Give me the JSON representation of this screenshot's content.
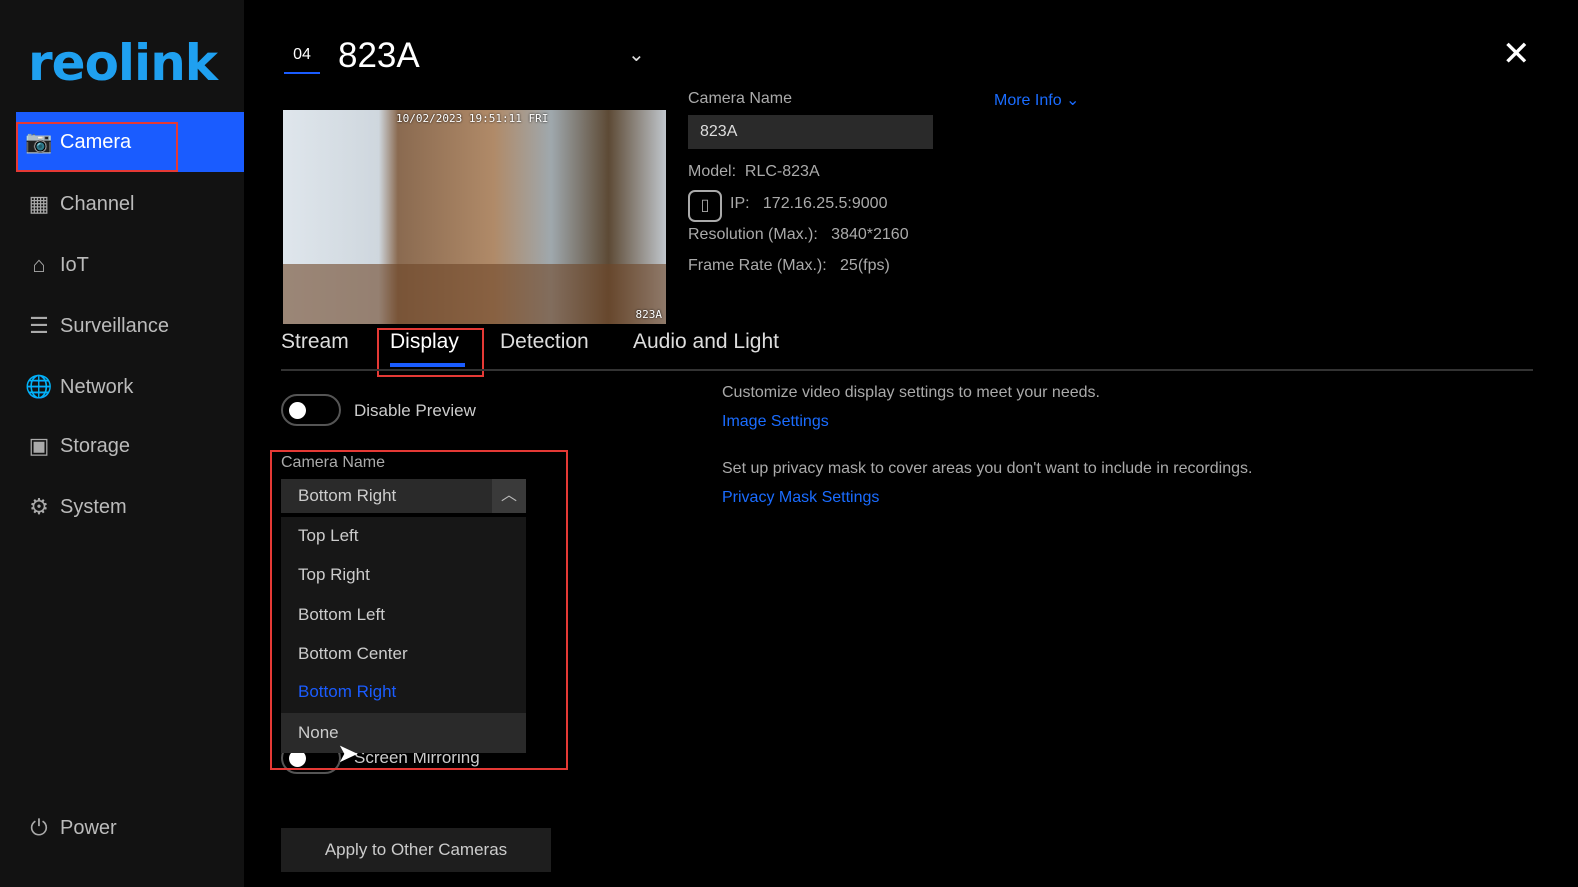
{
  "brand": "reolink",
  "sidebar": {
    "items": [
      {
        "label": "Camera",
        "icon": "camera-icon",
        "active": true
      },
      {
        "label": "Channel",
        "icon": "grid-icon"
      },
      {
        "label": "IoT",
        "icon": "home-icon"
      },
      {
        "label": "Surveillance",
        "icon": "list-icon"
      },
      {
        "label": "Network",
        "icon": "globe-icon"
      },
      {
        "label": "Storage",
        "icon": "storage-icon"
      },
      {
        "label": "System",
        "icon": "gear-icon"
      }
    ],
    "power": "Power"
  },
  "header": {
    "channel": "04",
    "title": "823A"
  },
  "preview": {
    "timestamp": "10/02/2023 19:51:11 FRI",
    "overlay_name": "823A"
  },
  "info": {
    "camera_name_label": "Camera Name",
    "camera_name_value": "823A",
    "more_info": "More Info",
    "model_label": "Model:",
    "model": "RLC-823A",
    "ip_label": "IP:",
    "ip": "172.16.25.5:9000",
    "resolution_label": "Resolution (Max.):",
    "resolution": "3840*2160",
    "framerate_label": "Frame Rate (Max.):",
    "framerate": "25(fps)"
  },
  "tabs": [
    "Stream",
    "Display",
    "Detection",
    "Audio and Light"
  ],
  "display": {
    "disable_preview": "Disable Preview",
    "camera_name_label": "Camera Name",
    "selected": "Bottom Right",
    "options": [
      "Top Left",
      "Top Right",
      "Bottom Left",
      "Bottom Center",
      "Bottom Right",
      "None"
    ],
    "screen_mirroring": "Screen Mirroring",
    "apply": "Apply to Other Cameras",
    "image_desc": "Customize video display settings to meet your needs.",
    "image_link": "Image Settings",
    "privacy_desc": "Set up privacy mask to cover areas you don't want to include in recordings.",
    "privacy_link": "Privacy Mask Settings"
  },
  "colors": {
    "accent": "#1a5cff",
    "highlight": "#e53935"
  }
}
